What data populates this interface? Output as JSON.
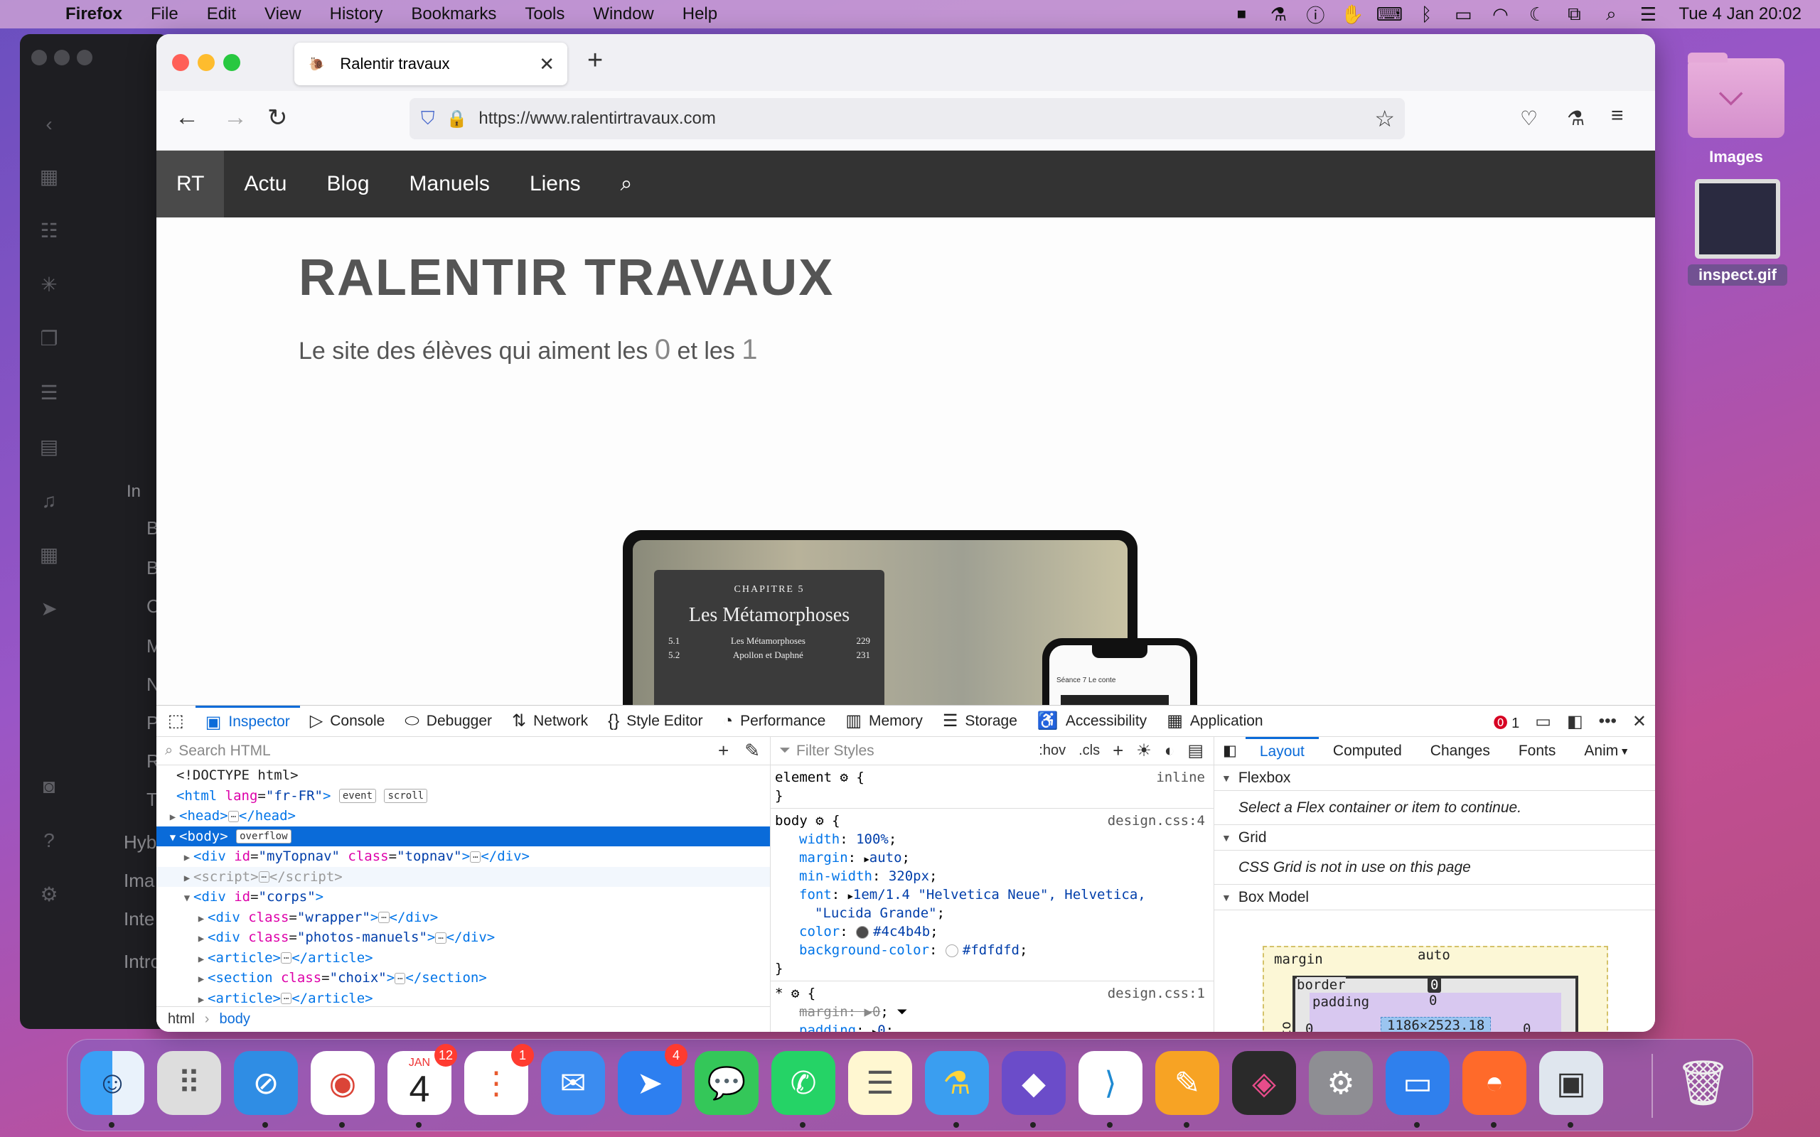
{
  "menubar": {
    "app": "Firefox",
    "items": [
      "File",
      "Edit",
      "View",
      "History",
      "Bookmarks",
      "Tools",
      "Window",
      "Help"
    ],
    "clock": "Tue 4 Jan  20:02"
  },
  "desktop": {
    "folder_label": "Images",
    "file_label": "inspect.gif"
  },
  "bg_window": {
    "items": [
      "Hyb",
      "Ima",
      "Inte",
      "Intro"
    ],
    "letters": [
      "In",
      "B",
      "B",
      "C",
      "M",
      "N",
      "Pr",
      "R",
      "T"
    ]
  },
  "browser": {
    "tab_title": "Ralentir travaux",
    "url": "https://www.ralentirtravaux.com",
    "page": {
      "nav": [
        "RT",
        "Actu",
        "Blog",
        "Manuels",
        "Liens"
      ],
      "title": "RALENTIR TRAVAUX",
      "subtitle_start": "Le site des élèves qui aiment les ",
      "zero": "0",
      "subtitle_mid": " et les ",
      "one": "1",
      "tablet": {
        "chapter": "CHAPITRE 5",
        "heading": "Les Métamorphoses",
        "rows": [
          {
            "num": "5.1",
            "label": "Les Métamorphoses",
            "page": "229"
          },
          {
            "num": "5.2",
            "label": "Apollon et Daphné",
            "page": "231"
          }
        ]
      },
      "phone_text": "Séance 7 Le conte"
    }
  },
  "devtools": {
    "tabs": [
      {
        "label": "Inspector",
        "icon": "inspector-icon"
      },
      {
        "label": "Console",
        "icon": "console-icon"
      },
      {
        "label": "Debugger",
        "icon": "debugger-icon"
      },
      {
        "label": "Network",
        "icon": "network-icon"
      },
      {
        "label": "Style Editor",
        "icon": "style-editor-icon"
      },
      {
        "label": "Performance",
        "icon": "performance-icon"
      },
      {
        "label": "Memory",
        "icon": "memory-icon"
      },
      {
        "label": "Storage",
        "icon": "storage-icon"
      },
      {
        "label": "Accessibility",
        "icon": "accessibility-icon"
      },
      {
        "label": "Application",
        "icon": "application-icon"
      }
    ],
    "error_count": "1",
    "search_placeholder": "Search HTML",
    "filter_placeholder": "Filter Styles",
    "hov": ":hov",
    "cls": ".cls",
    "tree": {
      "doctype": "<!DOCTYPE html>",
      "html_lang": "fr-FR",
      "badge_event": "event",
      "badge_scroll": "scroll",
      "badge_overflow": "overflow",
      "topnav_id": "myTopnav",
      "topnav_class": "topnav",
      "corps_id": "corps",
      "wrapper_class": "wrapper",
      "photos_class": "photos-manuels",
      "choix_class": "choix"
    },
    "breadcrumb": [
      "html",
      "body"
    ],
    "rules": {
      "element_selector": "element",
      "inline": "inline",
      "body_selector": "body",
      "body_src": "design.css:4",
      "body_decls": [
        {
          "prop": "width",
          "val": "100%"
        },
        {
          "prop": "margin",
          "val": "auto"
        },
        {
          "prop": "min-width",
          "val": "320px"
        },
        {
          "prop": "font",
          "val": "1em/1.4 \"Helvetica Neue\", Helvetica,"
        },
        {
          "prop": "",
          "val": "\"Lucida Grande\""
        },
        {
          "prop": "color",
          "val": "#4c4b4b"
        },
        {
          "prop": "background-color",
          "val": "#fdfdfd"
        }
      ],
      "star_selector": "*",
      "star_src": "design.css:1",
      "star_decls": [
        {
          "prop": "margin",
          "val": "0"
        },
        {
          "prop": "padding",
          "val": "0"
        }
      ]
    },
    "layout": {
      "tabs": [
        "Layout",
        "Computed",
        "Changes",
        "Fonts",
        "Anim"
      ],
      "flexbox": "Flexbox",
      "flex_note": "Select a Flex container or item to continue.",
      "grid": "Grid",
      "grid_note": "CSS Grid is not in use on this page",
      "boxmodel": "Box Model",
      "bm_margin": "margin",
      "bm_margin_top": "auto",
      "bm_border": "border",
      "bm_border_top": "0",
      "bm_padding": "padding",
      "bm_padding_top": "0",
      "bm_left": "auto",
      "bm_zero_left": "0",
      "bm_zero_right": "0",
      "bm_content": "1186×2523.18"
    }
  },
  "dock": {
    "calendar_month": "JAN",
    "calendar_day": "4",
    "badges": {
      "calendar": "12",
      "reminders": "1",
      "spark": "4"
    }
  },
  "colors": {
    "accent": "#0a6bd9",
    "topnav_bg": "#333333",
    "body_color": "#4c4b4b",
    "body_bg": "#fdfdfd"
  }
}
